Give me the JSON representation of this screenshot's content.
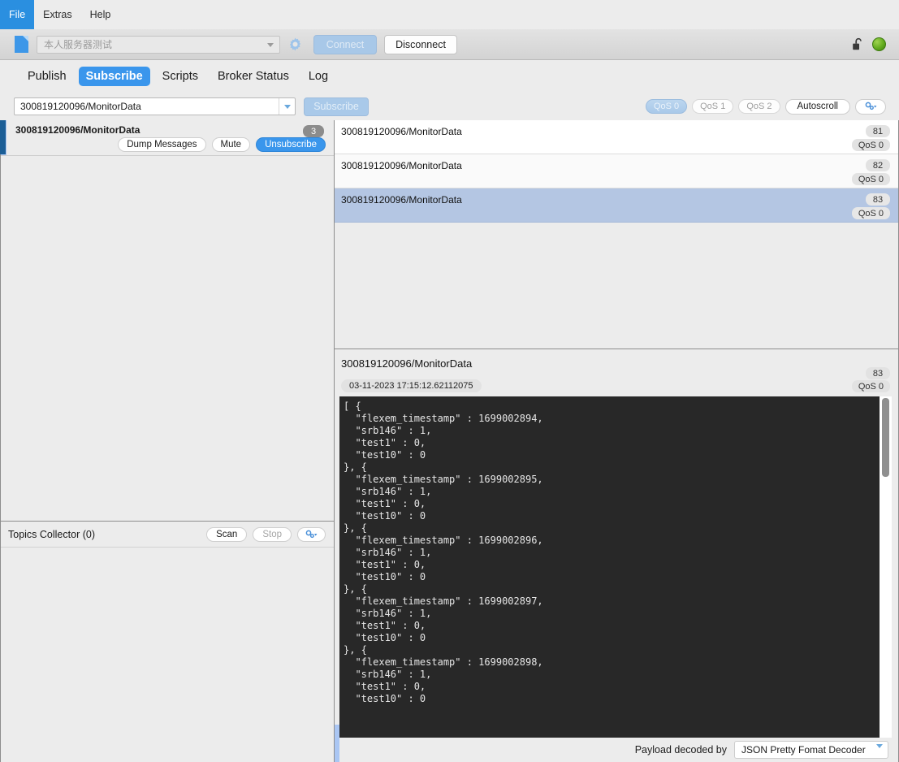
{
  "menu": {
    "items": [
      {
        "label": "File",
        "active": true
      },
      {
        "label": "Extras",
        "active": false
      },
      {
        "label": "Help",
        "active": false
      }
    ]
  },
  "toolbar": {
    "broker_profile_placeholder": "本人服务器测试",
    "broker_profile_value": "",
    "settings_icon": "gear-icon",
    "connect_label": "Connect",
    "disconnect_label": "Disconnect",
    "lock_icon": "unlocked-padlock-icon",
    "status_color": "#62ab1e"
  },
  "tabs": [
    {
      "label": "Publish",
      "active": false
    },
    {
      "label": "Subscribe",
      "active": true
    },
    {
      "label": "Scripts",
      "active": false
    },
    {
      "label": "Broker Status",
      "active": false
    },
    {
      "label": "Log",
      "active": false
    }
  ],
  "subscribe_bar": {
    "topic_value": "300819120096/MonitorData",
    "subscribe_label": "Subscribe",
    "qos_options": [
      {
        "label": "QoS 0",
        "selected": true
      },
      {
        "label": "QoS 1",
        "selected": false
      },
      {
        "label": "QoS 2",
        "selected": false
      }
    ],
    "autoscroll_label": "Autoscroll",
    "options_icon": "settings-dropdown-icon"
  },
  "subscriptions": [
    {
      "topic": "300819120096/MonitorData",
      "count": "3",
      "dump_label": "Dump Messages",
      "mute_label": "Mute",
      "unsubscribe_label": "Unsubscribe"
    }
  ],
  "topics_collector": {
    "title": "Topics Collector (0)",
    "scan_label": "Scan",
    "stop_label": "Stop",
    "options_icon": "settings-dropdown-icon"
  },
  "messages": [
    {
      "topic": "300819120096/MonitorData",
      "id": "81",
      "qos": "QoS 0",
      "selected": false
    },
    {
      "topic": "300819120096/MonitorData",
      "id": "82",
      "qos": "QoS 0",
      "selected": false
    },
    {
      "topic": "300819120096/MonitorData",
      "id": "83",
      "qos": "QoS 0",
      "selected": true
    }
  ],
  "detail": {
    "topic": "300819120096/MonitorData",
    "id": "83",
    "qos": "QoS 0",
    "timestamp": "03-11-2023  17:15:12.62112075",
    "payload": "[ {\n  \"flexem_timestamp\" : 1699002894,\n  \"srb146\" : 1,\n  \"test1\" : 0,\n  \"test10\" : 0\n}, {\n  \"flexem_timestamp\" : 1699002895,\n  \"srb146\" : 1,\n  \"test1\" : 0,\n  \"test10\" : 0\n}, {\n  \"flexem_timestamp\" : 1699002896,\n  \"srb146\" : 1,\n  \"test1\" : 0,\n  \"test10\" : 0\n}, {\n  \"flexem_timestamp\" : 1699002897,\n  \"srb146\" : 1,\n  \"test1\" : 0,\n  \"test10\" : 0\n}, {\n  \"flexem_timestamp\" : 1699002898,\n  \"srb146\" : 1,\n  \"test1\" : 0,\n  \"test10\" : 0"
  },
  "decoder": {
    "label": "Payload decoded by",
    "selected": "JSON Pretty Fomat Decoder"
  }
}
